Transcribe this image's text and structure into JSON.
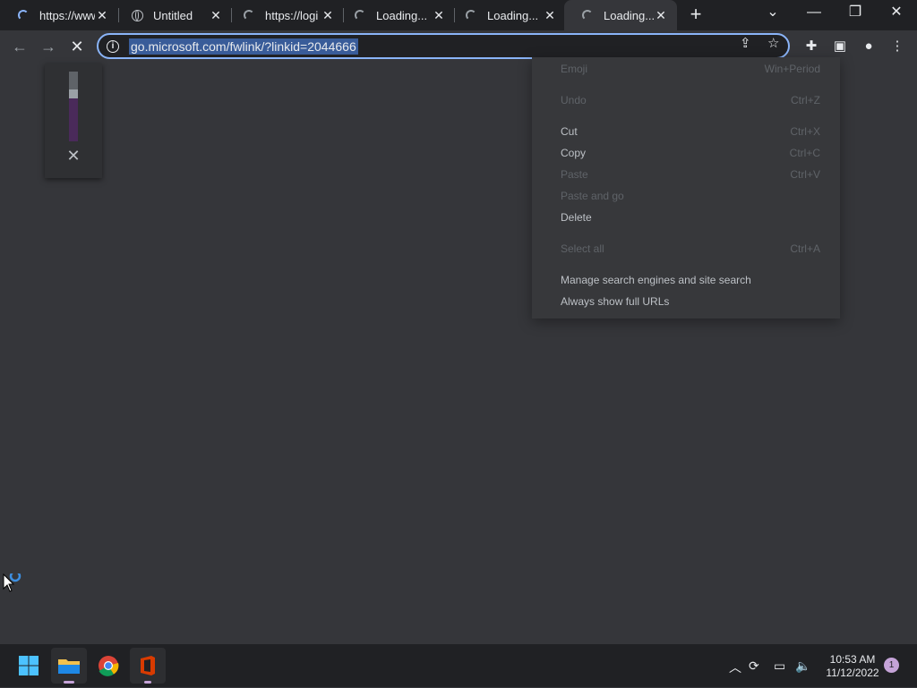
{
  "tabs": [
    {
      "title": "https://www",
      "favicon": "loading-spinner-icon"
    },
    {
      "title": "Untitled",
      "favicon": "globe-icon"
    },
    {
      "title": "https://logi",
      "favicon": "loading-spinner-icon"
    },
    {
      "title": "Loading...",
      "favicon": "loading-spinner-icon"
    },
    {
      "title": "Loading...",
      "favicon": "loading-spinner-icon"
    },
    {
      "title": "Loading...",
      "favicon": "loading-spinner-icon",
      "active": true
    }
  ],
  "omnibox": {
    "url": "go.microsoft.com/fwlink/?linkid=2044666"
  },
  "context_menu": {
    "items": [
      {
        "label": "Emoji",
        "shortcut": "Win+Period",
        "enabled": false
      },
      {
        "label": "Undo",
        "shortcut": "Ctrl+Z",
        "enabled": false
      },
      {
        "label": "Cut",
        "shortcut": "Ctrl+X",
        "enabled": true
      },
      {
        "label": "Copy",
        "shortcut": "Ctrl+C",
        "enabled": true
      },
      {
        "label": "Paste",
        "shortcut": "Ctrl+V",
        "enabled": false
      },
      {
        "label": "Paste and go",
        "shortcut": "",
        "enabled": false
      },
      {
        "label": "Delete",
        "shortcut": "",
        "enabled": true
      },
      {
        "label": "Select all",
        "shortcut": "Ctrl+A",
        "enabled": false
      },
      {
        "label": "Manage search engines and site search",
        "shortcut": "",
        "enabled": true
      },
      {
        "label": "Always show full URLs",
        "shortcut": "",
        "enabled": true
      }
    ]
  },
  "taskbar": {
    "apps": [
      "start-icon",
      "file-explorer-icon",
      "chrome-icon",
      "office-icon"
    ],
    "clock_time": "10:53 AM",
    "clock_date": "11/12/2022",
    "notification_count": "1"
  },
  "colors": {
    "accent": "#8ab4f8",
    "background": "#35363a",
    "tabstrip": "#202124"
  }
}
